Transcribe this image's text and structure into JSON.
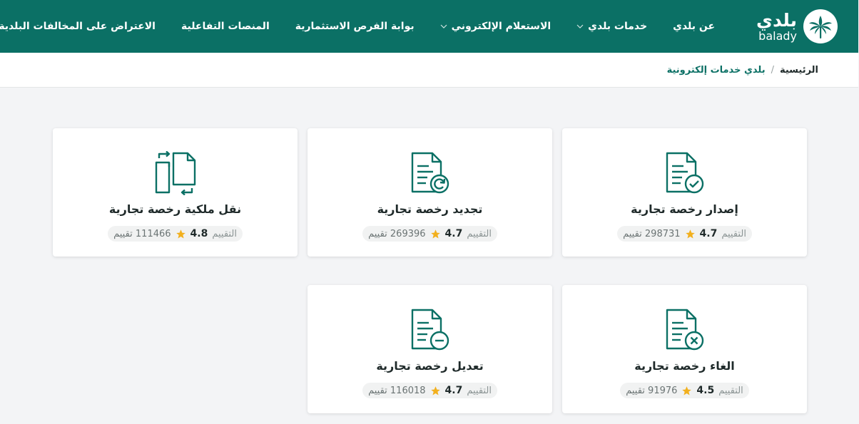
{
  "brand": {
    "name_ar": "بلدي",
    "name_en": "balady"
  },
  "nav": [
    {
      "label": "عن بلدي",
      "dropdown": false
    },
    {
      "label": "خدمات بلدي",
      "dropdown": true
    },
    {
      "label": "الاستعلام الإلكتروني",
      "dropdown": true
    },
    {
      "label": "بوابة الفرص الاستثمارية",
      "dropdown": false
    },
    {
      "label": "المنصات التفاعلية",
      "dropdown": false
    },
    {
      "label": "الاعتراض على المخالفات البلدية",
      "dropdown": false
    }
  ],
  "breadcrumb": {
    "home": "الرئيسية",
    "separator": "/",
    "current": "بلدي خدمات إلكترونية"
  },
  "rating_label": "التقييم",
  "cards": [
    {
      "title": "إصدار رخصة تجارية",
      "icon": "document-check-icon",
      "score": "4.7",
      "count": "298731 تقييم"
    },
    {
      "title": "تجديد رخصة تجارية",
      "icon": "document-renew-icon",
      "score": "4.7",
      "count": "269396 تقييم"
    },
    {
      "title": "نقل ملكية رخصة تجارية",
      "icon": "transfer-documents-icon",
      "score": "4.8",
      "count": "111466 تقييم"
    },
    {
      "title": "الغاء رخصة تجارية",
      "icon": "document-cancel-icon",
      "score": "4.5",
      "count": "91976 تقييم"
    },
    {
      "title": "تعديل رخصة تجارية",
      "icon": "document-edit-icon",
      "score": "4.7",
      "count": "116018 تقييم"
    }
  ],
  "colors": {
    "primary": "#0b7065",
    "star": "#f2b01e",
    "background": "#f3f4f6"
  }
}
